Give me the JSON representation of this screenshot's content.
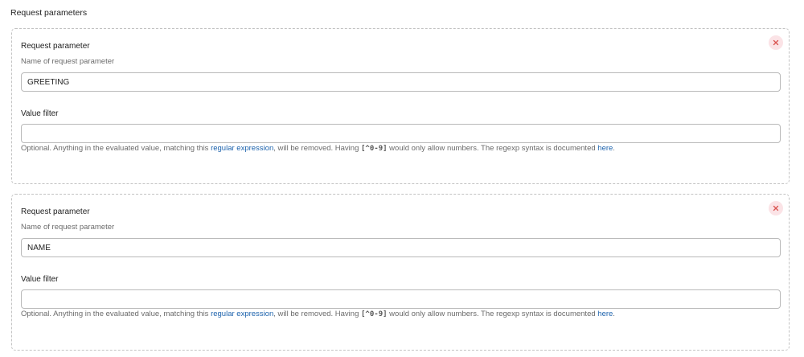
{
  "section": {
    "title": "Request parameters"
  },
  "params": [
    {
      "label": "Request parameter",
      "description": "Name of request parameter",
      "name_value": "GREETING",
      "filter_label": "Value filter",
      "filter_value": "",
      "help": {
        "part1": "Optional. Anything in the evaluated value, matching this ",
        "link_regex": "regular expression",
        "part2": ", will be removed. Having ",
        "code": "[^0-9]",
        "part3": " would only allow numbers. The regexp syntax is documented ",
        "link_here": "here",
        "part4": "."
      }
    },
    {
      "label": "Request parameter",
      "description": "Name of request parameter",
      "name_value": "NAME",
      "filter_label": "Value filter",
      "filter_value": "",
      "help": {
        "part1": "Optional. Anything in the evaluated value, matching this ",
        "link_regex": "regular expression",
        "part2": ", will be removed. Having ",
        "code": "[^0-9]",
        "part3": " would only allow numbers. The regexp syntax is documented ",
        "link_here": "here",
        "part4": "."
      }
    }
  ],
  "colors": {
    "link": "#1d63ad",
    "delete_bg": "#fbe3e6",
    "delete_icon": "#d9534f",
    "border": "#c2c2c2"
  },
  "icons": {
    "delete": "close-icon"
  }
}
